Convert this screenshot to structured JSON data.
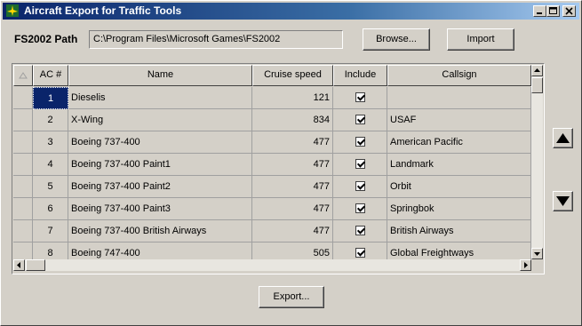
{
  "window": {
    "title": "Aircraft Export for Traffic Tools"
  },
  "path": {
    "label": "FS2002 Path",
    "value": "C:\\Program Files\\Microsoft Games\\FS2002"
  },
  "buttons": {
    "browse": "Browse...",
    "import": "Import",
    "export": "Export..."
  },
  "table": {
    "columns": [
      "AC #",
      "Name",
      "Cruise speed",
      "Include",
      "Callsign"
    ],
    "rows": [
      {
        "ac": "1",
        "name": "Dieselis",
        "speed": "121",
        "include": true,
        "callsign": "",
        "selected": true
      },
      {
        "ac": "2",
        "name": "X-Wing",
        "speed": "834",
        "include": true,
        "callsign": "USAF"
      },
      {
        "ac": "3",
        "name": "Boeing 737-400",
        "speed": "477",
        "include": true,
        "callsign": "American Pacific"
      },
      {
        "ac": "4",
        "name": "Boeing 737-400 Paint1",
        "speed": "477",
        "include": true,
        "callsign": "Landmark"
      },
      {
        "ac": "5",
        "name": "Boeing 737-400 Paint2",
        "speed": "477",
        "include": true,
        "callsign": "Orbit"
      },
      {
        "ac": "6",
        "name": "Boeing 737-400 Paint3",
        "speed": "477",
        "include": true,
        "callsign": "Springbok"
      },
      {
        "ac": "7",
        "name": "Boeing 737-400 British Airways",
        "speed": "477",
        "include": true,
        "callsign": "British Airways"
      },
      {
        "ac": "8",
        "name": "Boeing 747-400",
        "speed": "505",
        "include": true,
        "callsign": "Global Freightways"
      }
    ]
  },
  "icons": {
    "app": "aircraft-icon",
    "move_up": "up-arrow-icon",
    "move_down": "down-arrow-icon"
  },
  "colors": {
    "title_start": "#0a246a",
    "title_end": "#a6caf0",
    "selection": "#0a246a",
    "face": "#d4d0c8"
  }
}
